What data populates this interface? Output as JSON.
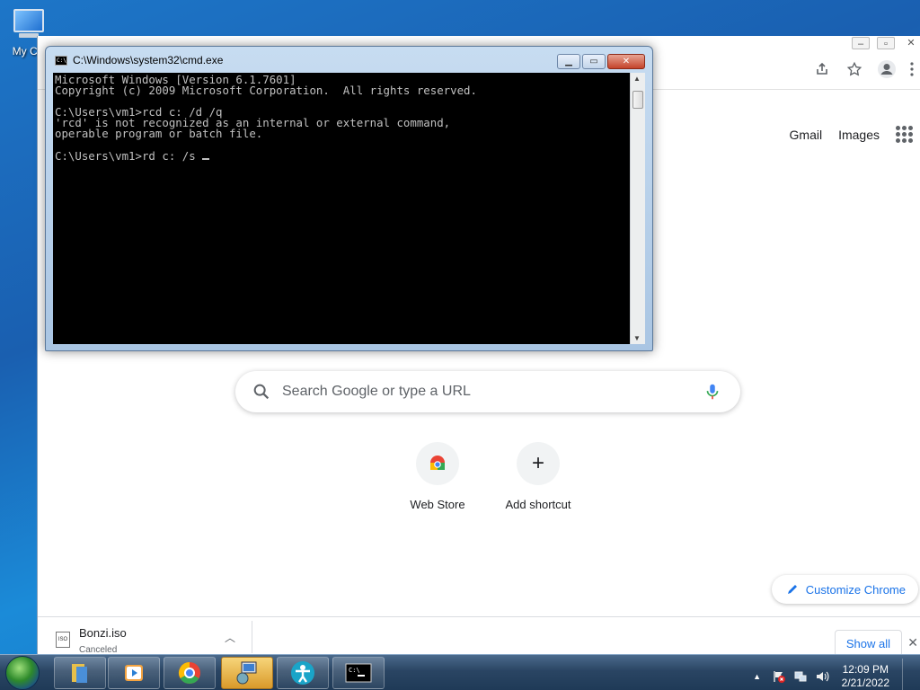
{
  "desktop": {
    "icon_label": "My Co"
  },
  "chrome": {
    "links": {
      "gmail": "Gmail",
      "images": "Images"
    },
    "search": {
      "placeholder": "Search Google or type a URL"
    },
    "shortcuts": [
      {
        "label": "Web Store"
      },
      {
        "label": "Add shortcut"
      }
    ],
    "customize_label": "Customize Chrome",
    "download": {
      "file_name": "Bonzi.iso",
      "status": "Canceled",
      "file_type": "ISO",
      "show_all": "Show all"
    }
  },
  "cmd": {
    "title": "C:\\Windows\\system32\\cmd.exe",
    "lines": [
      "Microsoft Windows [Version 6.1.7601]",
      "Copyright (c) 2009 Microsoft Corporation.  All rights reserved.",
      "",
      "C:\\Users\\vm1>rcd c: /d /q",
      "'rcd' is not recognized as an internal or external command,",
      "operable program or batch file.",
      "",
      "C:\\Users\\vm1>rd c: /s "
    ]
  },
  "taskbar": {
    "time": "12:09 PM",
    "date": "2/21/2022"
  },
  "colors": {
    "accent": "#1a73e8",
    "console_bg": "#000000",
    "console_fg": "#c0c0c0"
  }
}
